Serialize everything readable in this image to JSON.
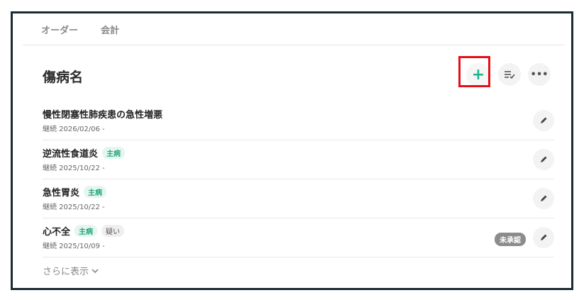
{
  "tabs": [
    {
      "label": "オーダー"
    },
    {
      "label": "会計"
    }
  ],
  "section": {
    "title": "傷病名"
  },
  "actions": {
    "add_icon": "plus-icon",
    "sort_icon": "list-check-icon",
    "more_icon": "ellipsis-icon"
  },
  "highlight_color": "#e3101a",
  "accent_color": "#1fb58f",
  "diagnoses": [
    {
      "name": "慢性閉塞性肺疾患の急性増悪",
      "status": "継続 2026/02/06 -",
      "tags": [],
      "pending": ""
    },
    {
      "name": "逆流性食道炎",
      "status": "継続 2025/10/22 -",
      "tags": [
        "主病"
      ],
      "pending": ""
    },
    {
      "name": "急性胃炎",
      "status": "継続 2025/10/22 -",
      "tags": [
        "主病"
      ],
      "pending": ""
    },
    {
      "name": "心不全",
      "status": "継続 2025/10/09 -",
      "tags": [
        "主病",
        "疑い"
      ],
      "pending": "未承認"
    }
  ],
  "footer": {
    "show_more": "さらに表示"
  }
}
